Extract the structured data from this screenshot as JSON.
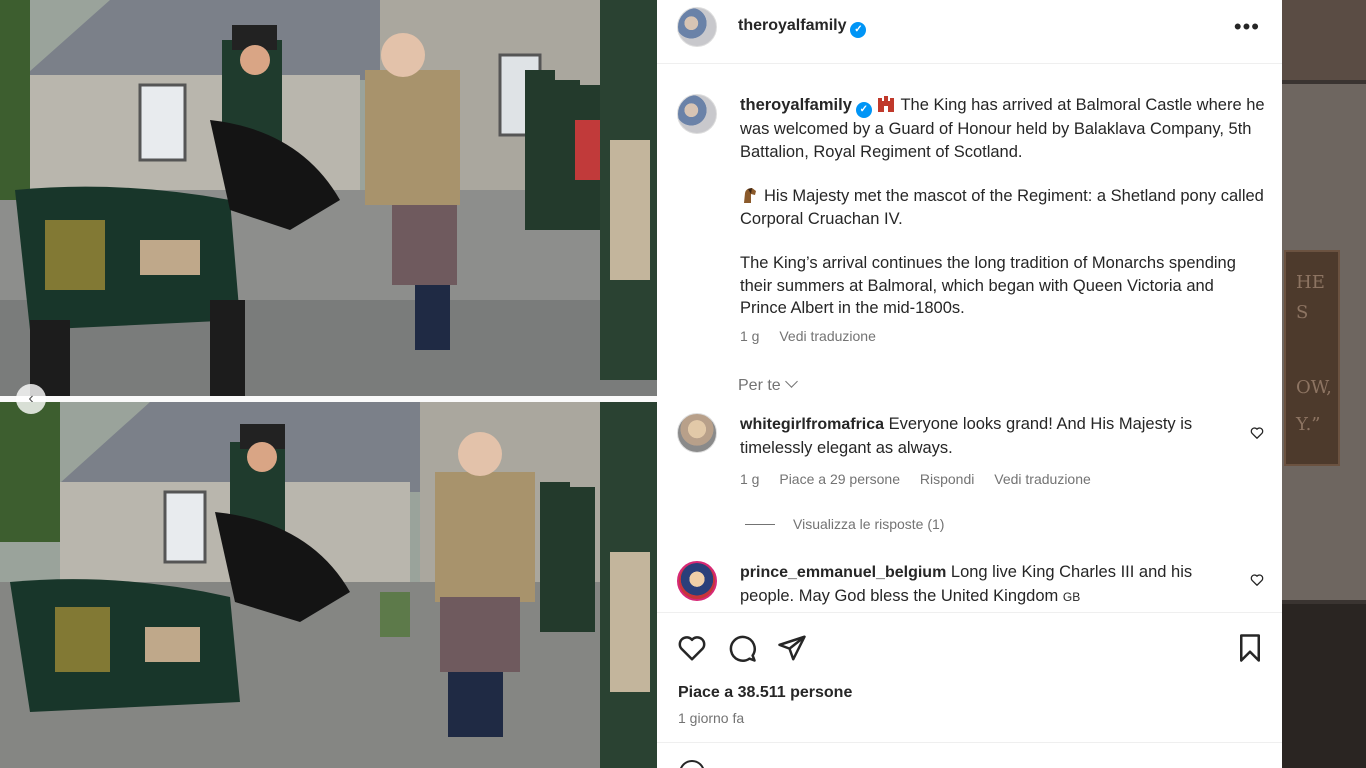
{
  "post": {
    "username": "theroyalfamily",
    "caption": {
      "para1_text": "The King has arrived at Balmoral Castle where he was welcomed by a Guard of Honour held by Balaklava Company, 5th Battalion, Royal Regiment of Scotland.",
      "para2_text": "His Majesty met the mascot of the Regiment: a Shetland pony called Corporal Cruachan IV.",
      "para3_text": "The King’s arrival continues the long tradition of Monarchs spending their summers at Balmoral, which began with Queen Victoria and Prince Albert in the mid-1800s.",
      "time": "1 g",
      "translate_label": "Vedi traduzione"
    },
    "per_te_label": "Per te",
    "comments": [
      {
        "username": "whitegirlfromafrica",
        "text": "Everyone looks grand! And His Majesty is timelessly elegant as always.",
        "time": "1 g",
        "likes": "Piace a 29 persone",
        "reply_label": "Rispondi",
        "translate_label": "Vedi traduzione",
        "view_replies_label": "Visualizza le risposte (1)"
      },
      {
        "username": "prince_emmanuel_belgium",
        "text": "Long live King Charles III and his people. May God bless the United Kingdom",
        "flag_text": "GB"
      }
    ],
    "likes_label": "Piace a 38.511 persone",
    "date_label": "1 giorno fa"
  },
  "background": {
    "plaque_letters": [
      "HE",
      "S",
      "OW,",
      "Y.”"
    ]
  },
  "icons": {
    "heart": "heart-icon",
    "comment": "comment-icon",
    "share": "share-icon",
    "save": "bookmark-icon",
    "more": "more-options-icon",
    "verified": "verified-badge-icon",
    "prev": "chevron-left-icon"
  },
  "colors": {
    "verified": "#0095f6",
    "text": "#262626",
    "secondary": "#737373"
  }
}
